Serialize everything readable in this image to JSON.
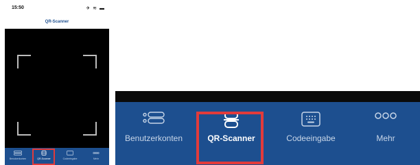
{
  "status_bar": {
    "time": "15:50",
    "icons": "✈ ≋ ▬"
  },
  "nav": {
    "title": "QR-Scanner"
  },
  "tabs": [
    {
      "label": "Benutzerkonten",
      "icon": "list-icon"
    },
    {
      "label": "QR-Scanner",
      "icon": "scanner-icon",
      "active": true
    },
    {
      "label": "Codeeingabe",
      "icon": "keypad-icon"
    },
    {
      "label": "Mehr",
      "icon": "more-icon"
    }
  ],
  "colors": {
    "tabbar": "#1d4f8f",
    "highlight": "#e23b3b"
  }
}
